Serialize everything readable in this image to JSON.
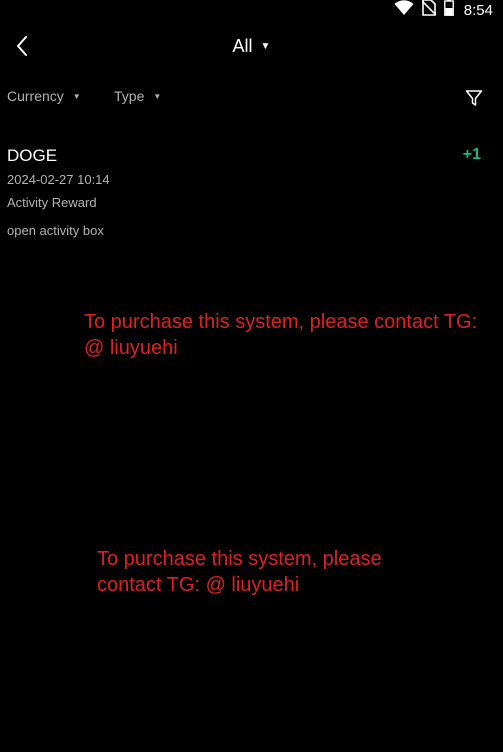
{
  "status_bar": {
    "time": "8:54",
    "icons": [
      "wifi-icon",
      "no-sim-icon",
      "battery-icon"
    ]
  },
  "header": {
    "back_icon": "chevron-left-icon",
    "title": "All"
  },
  "filters": {
    "currency_label": "Currency",
    "type_label": "Type",
    "filter_icon": "funnel-icon"
  },
  "records": [
    {
      "currency": "DOGE",
      "amount": "+1",
      "time": "2024-02-27 10:14",
      "type": "Activity Reward",
      "note": "open activity box"
    }
  ],
  "watermarks": [
    "To purchase this system, please contact TG: @ liuyuehi",
    "To purchase this system, please contact TG: @ liuyuehi"
  ],
  "colors": {
    "background": "#000000",
    "positive": "#1ab58a",
    "secondary_text": "#b3b3b3",
    "watermark": "#e02020"
  }
}
